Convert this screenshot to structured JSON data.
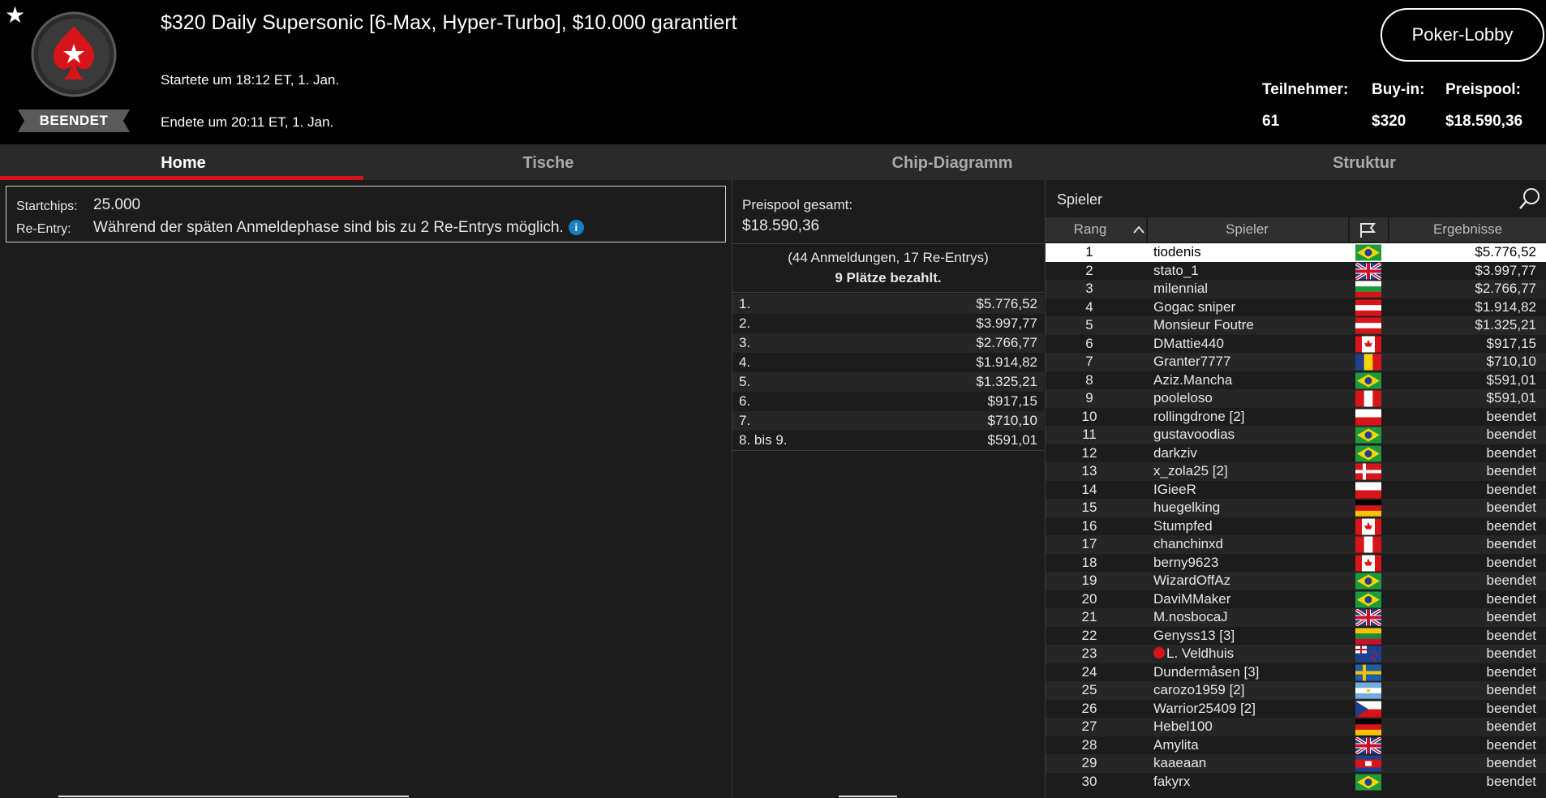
{
  "header": {
    "title": "$320 Daily Supersonic [6-Max, Hyper-Turbo], $10.000 garantiert",
    "status_badge": "BEENDET",
    "started": "Startete um 18:12 ET, 1. Jan.",
    "ended": "Endete um 20:11 ET, 1. Jan.",
    "lobby_button": "Poker-Lobby",
    "stats": [
      {
        "label": "Teilnehmer:",
        "value": "61"
      },
      {
        "label": "Buy-in:",
        "value": "$320"
      },
      {
        "label": "Preispool:",
        "value": "$18.590,36"
      }
    ],
    "accent_color": "#d7141a"
  },
  "tabs": [
    {
      "label": "Home",
      "active": true
    },
    {
      "label": "Tische"
    },
    {
      "label": "Chip-Diagramm"
    },
    {
      "label": "Struktur"
    }
  ],
  "home": {
    "startchips_label": "Startchips:",
    "startchips_value": "25.000",
    "reentry_label": "Re-Entry:",
    "reentry_value": "Während der späten Anmeldephase sind bis zu 2 Re-Entrys möglich.",
    "info_icon": "i"
  },
  "prizepool": {
    "label": "Preispool gesamt:",
    "value": "$18.590,36",
    "entries": "(44 Anmeldungen, 17 Re-Entrys)",
    "paid": "9 Plätze bezahlt.",
    "payouts": [
      {
        "place": "1.",
        "amount": "$5.776,52"
      },
      {
        "place": "2.",
        "amount": "$3.997,77"
      },
      {
        "place": "3.",
        "amount": "$2.766,77"
      },
      {
        "place": "4.",
        "amount": "$1.914,82"
      },
      {
        "place": "5.",
        "amount": "$1.325,21"
      },
      {
        "place": "6.",
        "amount": "$917,15"
      },
      {
        "place": "7.",
        "amount": "$710,10"
      },
      {
        "place": "8. bis 9.",
        "amount": "$591,01"
      }
    ]
  },
  "players": {
    "search_placeholder": "Spieler",
    "columns": {
      "rank": "Rang",
      "player": "Spieler",
      "results": "Ergebnisse"
    },
    "rows": [
      {
        "rank": "1",
        "name": "tiodenis",
        "flag": "br",
        "result": "$5.776,52"
      },
      {
        "rank": "2",
        "name": "stato_1",
        "flag": "gb",
        "result": "$3.997,77"
      },
      {
        "rank": "3",
        "name": "milennial",
        "flag": "bg",
        "result": "$2.766,77"
      },
      {
        "rank": "4",
        "name": "Gogac sniper",
        "flag": "at",
        "result": "$1.914,82"
      },
      {
        "rank": "5",
        "name": "Monsieur Foutre",
        "flag": "at",
        "result": "$1.325,21"
      },
      {
        "rank": "6",
        "name": "DMattie440",
        "flag": "ca",
        "result": "$917,15"
      },
      {
        "rank": "7",
        "name": "Granter7777",
        "flag": "ro",
        "result": "$710,10"
      },
      {
        "rank": "8",
        "name": "Aziz.Mancha",
        "flag": "br",
        "result": "$591,01"
      },
      {
        "rank": "9",
        "name": "pooleloso",
        "flag": "pe",
        "result": "$591,01"
      },
      {
        "rank": "10",
        "name": "rollingdrone [2]",
        "flag": "pl",
        "result": "beendet"
      },
      {
        "rank": "11",
        "name": "gustavoodias",
        "flag": "br",
        "result": "beendet"
      },
      {
        "rank": "12",
        "name": "darkziv",
        "flag": "br",
        "result": "beendet"
      },
      {
        "rank": "13",
        "name": "x_zola25 [2]",
        "flag": "dk",
        "result": "beendet"
      },
      {
        "rank": "14",
        "name": "IGieeR",
        "flag": "pl",
        "result": "beendet"
      },
      {
        "rank": "15",
        "name": "huegelking",
        "flag": "de",
        "result": "beendet"
      },
      {
        "rank": "16",
        "name": "Stumpfed",
        "flag": "ca",
        "result": "beendet"
      },
      {
        "rank": "17",
        "name": "chanchinxd",
        "flag": "pe",
        "result": "beendet"
      },
      {
        "rank": "18",
        "name": "berny9623",
        "flag": "ca",
        "result": "beendet"
      },
      {
        "rank": "19",
        "name": "WizardOffAz",
        "flag": "br",
        "result": "beendet"
      },
      {
        "rank": "20",
        "name": "DaviMMaker",
        "flag": "br",
        "result": "beendet"
      },
      {
        "rank": "21",
        "name": "M.nosbocaJ",
        "flag": "gb",
        "result": "beendet"
      },
      {
        "rank": "22",
        "name": "Genyss13 [3]",
        "flag": "lt",
        "result": "beendet"
      },
      {
        "rank": "23",
        "name": "L. Veldhuis",
        "flag": "nz",
        "result": "beendet",
        "pro": true
      },
      {
        "rank": "24",
        "name": "Dundermåsen [3]",
        "flag": "se",
        "result": "beendet"
      },
      {
        "rank": "25",
        "name": "carozo1959 [2]",
        "flag": "ar",
        "result": "beendet"
      },
      {
        "rank": "26",
        "name": "Warrior25409 [2]",
        "flag": "cz",
        "result": "beendet"
      },
      {
        "rank": "27",
        "name": "Hebel100",
        "flag": "de",
        "result": "beendet"
      },
      {
        "rank": "28",
        "name": "Amylita",
        "flag": "gb",
        "result": "beendet"
      },
      {
        "rank": "29",
        "name": "kaaeaan",
        "flag": "kh",
        "result": "beendet"
      },
      {
        "rank": "30",
        "name": "fakyrx",
        "flag": "br",
        "result": "beendet"
      }
    ]
  }
}
